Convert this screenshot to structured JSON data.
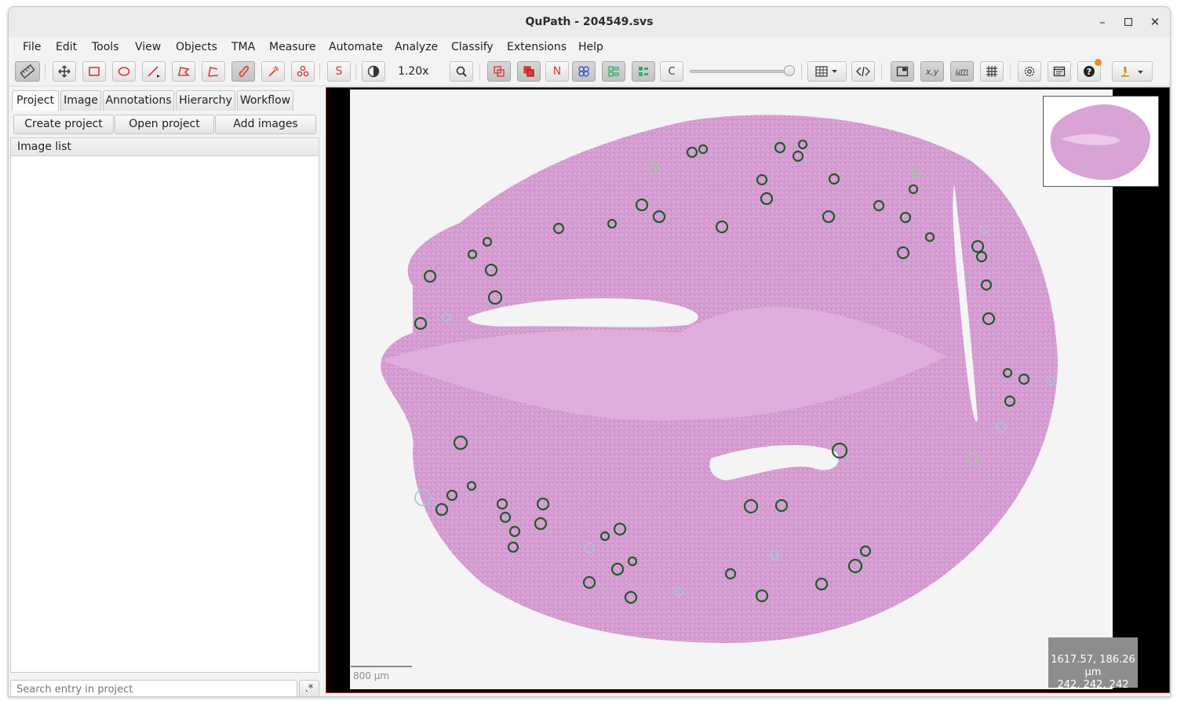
{
  "window": {
    "title": "QuPath - 204549.svs"
  },
  "menu": [
    "File",
    "Edit",
    "Tools",
    "View",
    "Objects",
    "TMA",
    "Measure",
    "Automate",
    "Analyze",
    "Classify",
    "Extensions",
    "Help"
  ],
  "toolbar": {
    "zoom_level": "1.20x",
    "selection_mode_label": "S",
    "names_toggle_label": "N",
    "cells_toggle_label": "C",
    "xy_label": "x,y",
    "micron_label": "µm",
    "opacity_level": 1.0
  },
  "left_panel": {
    "tabs": [
      "Project",
      "Image",
      "Annotations",
      "Hierarchy",
      "Workflow"
    ],
    "active_tab": "Project",
    "buttons": {
      "create": "Create project",
      "open": "Open project",
      "add": "Add images"
    },
    "list_header": "Image list",
    "search_placeholder": "Search entry in project",
    "regex_label": ".*"
  },
  "viewer": {
    "scalebar_label": "800 µm",
    "cursor_position": "1617.57, 186.26 µm",
    "cursor_rgb": "242, 242, 242"
  },
  "colors": {
    "accent_red": "#d83a3a",
    "tissue": "#d49ad0",
    "annotation_green": "#1f5c2a",
    "annotation_light": "#9fc7e6",
    "notification": "#f08c1a"
  }
}
